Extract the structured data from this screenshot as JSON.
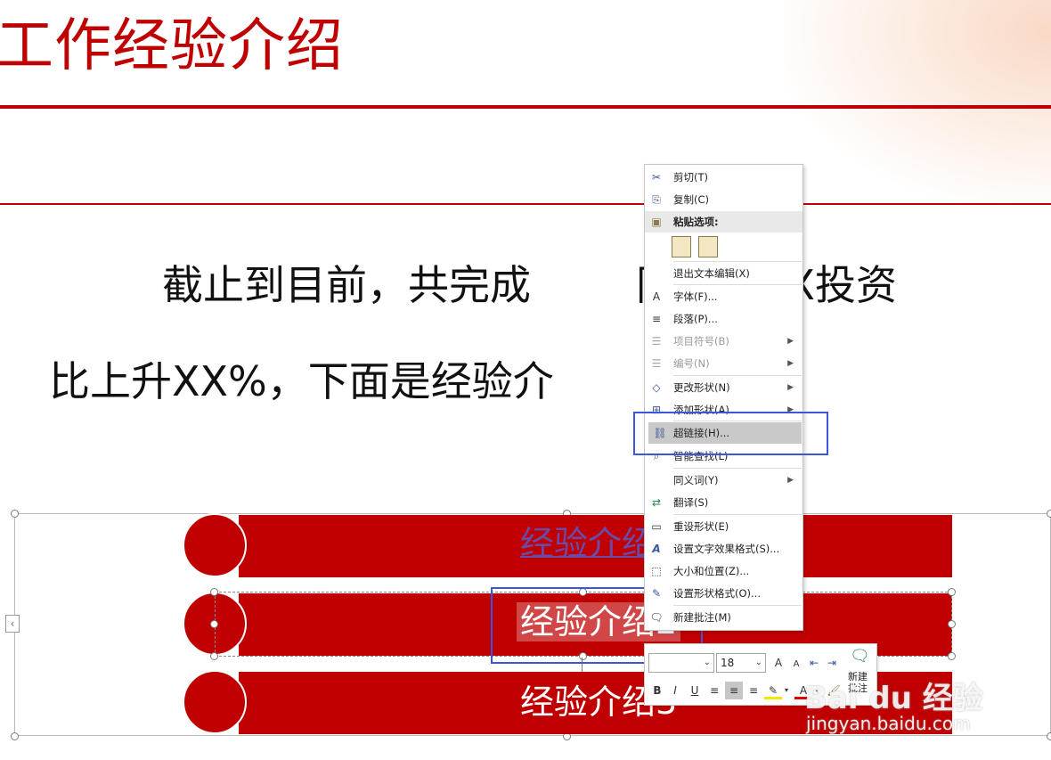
{
  "slide": {
    "title": "工作经验介绍",
    "paragraph_line1": "截止到目前，共完成",
    "paragraph_line1_right": "同额，XX投资",
    "paragraph_line2": "比上升XX%，下面是经验介",
    "bar_labels": [
      "经验介绍",
      "经验介绍2",
      "经验介绍3"
    ],
    "accent_color": "#c00000",
    "hyperlink_color": "#6b4aa8"
  },
  "context_menu": {
    "items": [
      {
        "label": "剪切(T)",
        "icon": "scissors-icon"
      },
      {
        "label": "复制(C)",
        "icon": "copy-icon"
      },
      {
        "label": "粘贴选项:",
        "icon": "paste-icon"
      },
      {
        "label": "退出文本编辑(X)"
      },
      {
        "label": "字体(F)...",
        "icon": "font-icon"
      },
      {
        "label": "段落(P)...",
        "icon": "paragraph-icon"
      },
      {
        "label": "项目符号(B)",
        "icon": "bullets-icon",
        "disabled": true
      },
      {
        "label": "编号(N)",
        "icon": "numbering-icon",
        "disabled": true
      },
      {
        "label": "更改形状(N)",
        "icon": "change-shape-icon"
      },
      {
        "label": "添加形状(A)",
        "icon": "add-shape-icon"
      },
      {
        "label": "超链接(H)...",
        "icon": "hyperlink-icon"
      },
      {
        "label": "智能查找(L)",
        "icon": "smart-lookup-icon"
      },
      {
        "label": "同义词(Y)"
      },
      {
        "label": "翻译(S)",
        "icon": "translate-icon"
      },
      {
        "label": "重设形状(E)",
        "icon": "reset-shape-icon"
      },
      {
        "label": "设置文字效果格式(S)...",
        "icon": "text-effects-icon"
      },
      {
        "label": "大小和位置(Z)...",
        "icon": "size-position-icon"
      },
      {
        "label": "设置形状格式(O)...",
        "icon": "format-shape-icon"
      },
      {
        "label": "新建批注(M)",
        "icon": "new-comment-icon"
      }
    ]
  },
  "mini_toolbar": {
    "font_name": "",
    "font_size": "18",
    "grow_font": "A",
    "shrink_font": "A",
    "bold": "B",
    "italic": "I",
    "underline": "U",
    "font_color": "A",
    "new_comment_line1": "新建",
    "new_comment_line2": "批注"
  },
  "watermark": {
    "logo": "Bai du 经验",
    "url": "jingyan.baidu.com"
  }
}
